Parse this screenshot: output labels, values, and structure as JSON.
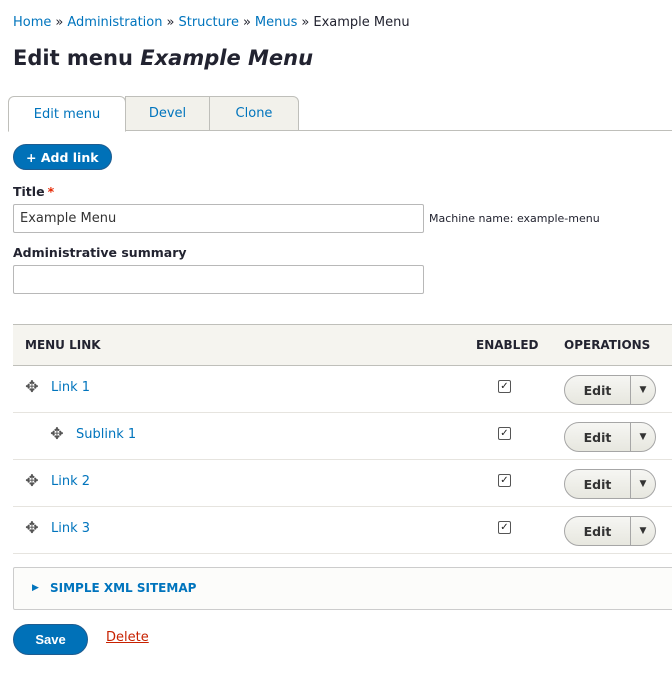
{
  "breadcrumb": {
    "items": [
      "Home",
      "Administration",
      "Structure",
      "Menus"
    ],
    "current": "Example Menu",
    "separator": "»"
  },
  "page_title": {
    "prefix": "Edit menu",
    "name": "Example Menu"
  },
  "tabs": [
    {
      "label": "Edit menu",
      "active": true
    },
    {
      "label": "Devel",
      "active": false
    },
    {
      "label": "Clone",
      "active": false
    }
  ],
  "add_link_label": "+ Add link",
  "form": {
    "title_label": "Title",
    "required_mark": "*",
    "title_value": "Example Menu",
    "machine_name": "Machine name: example-menu",
    "summary_label": "Administrative summary",
    "summary_value": ""
  },
  "table": {
    "headers": {
      "menu_link": "MENU LINK",
      "enabled": "ENABLED",
      "operations": "OPERATIONS"
    },
    "rows": [
      {
        "label": "Link 1",
        "enabled": true,
        "depth": 0,
        "op": "Edit"
      },
      {
        "label": "Sublink 1",
        "enabled": true,
        "depth": 1,
        "op": "Edit"
      },
      {
        "label": "Link 2",
        "enabled": true,
        "depth": 0,
        "op": "Edit"
      },
      {
        "label": "Link 3",
        "enabled": true,
        "depth": 0,
        "op": "Edit"
      }
    ]
  },
  "details": {
    "summary": "SIMPLE XML SITEMAP"
  },
  "actions": {
    "save": "Save",
    "delete": "Delete"
  },
  "colors": {
    "link": "#0074bd",
    "primary": "#0071b8",
    "danger": "#c72100"
  }
}
